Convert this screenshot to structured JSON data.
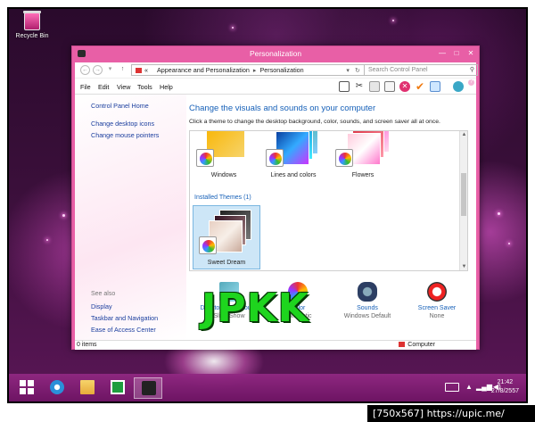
{
  "desktop": {
    "recycle_bin_label": "Recycle Bin"
  },
  "window": {
    "title": "Personalization",
    "controls": {
      "minimize": "—",
      "maximize": "□",
      "close": "✕"
    }
  },
  "address": {
    "prefix": "«",
    "breadcrumb": [
      "Appearance and Personalization",
      "Personalization"
    ],
    "search_placeholder": "Search Control Panel"
  },
  "menu": [
    "File",
    "Edit",
    "View",
    "Tools",
    "Help"
  ],
  "sidebar": {
    "home": "Control Panel Home",
    "links": [
      "Change desktop icons",
      "Change mouse pointers"
    ],
    "see_also_label": "See also",
    "see_also": [
      "Display",
      "Taskbar and Navigation",
      "Ease of Access Center"
    ]
  },
  "main": {
    "heading": "Change the visuals and sounds on your computer",
    "subtext": "Click a theme to change the desktop background, color, sounds, and screen saver all at once.",
    "themes": [
      {
        "name": "Windows"
      },
      {
        "name": "Lines and colors"
      },
      {
        "name": "Flowers"
      }
    ],
    "installed_label": "Installed Themes (1)",
    "installed": [
      {
        "name": "Sweet Dream",
        "selected": true
      }
    ],
    "bottom": [
      {
        "name": "Desktop Background",
        "value": "Slide Show"
      },
      {
        "name": "Color",
        "value": "Automatic"
      },
      {
        "name": "Sounds",
        "value": "Windows Default"
      },
      {
        "name": "Screen Saver",
        "value": "None"
      }
    ],
    "watermark": "JPKK"
  },
  "statusbar": {
    "items": "0 items",
    "computer": "Computer"
  },
  "taskbar": {
    "time": "21:42",
    "date": "27/8/2557"
  },
  "caption": "[750x567] https://upic.me/",
  "colors": {
    "window_frame": "#e85fa6",
    "link": "#1660b8",
    "watermark": "#1ed51e"
  }
}
